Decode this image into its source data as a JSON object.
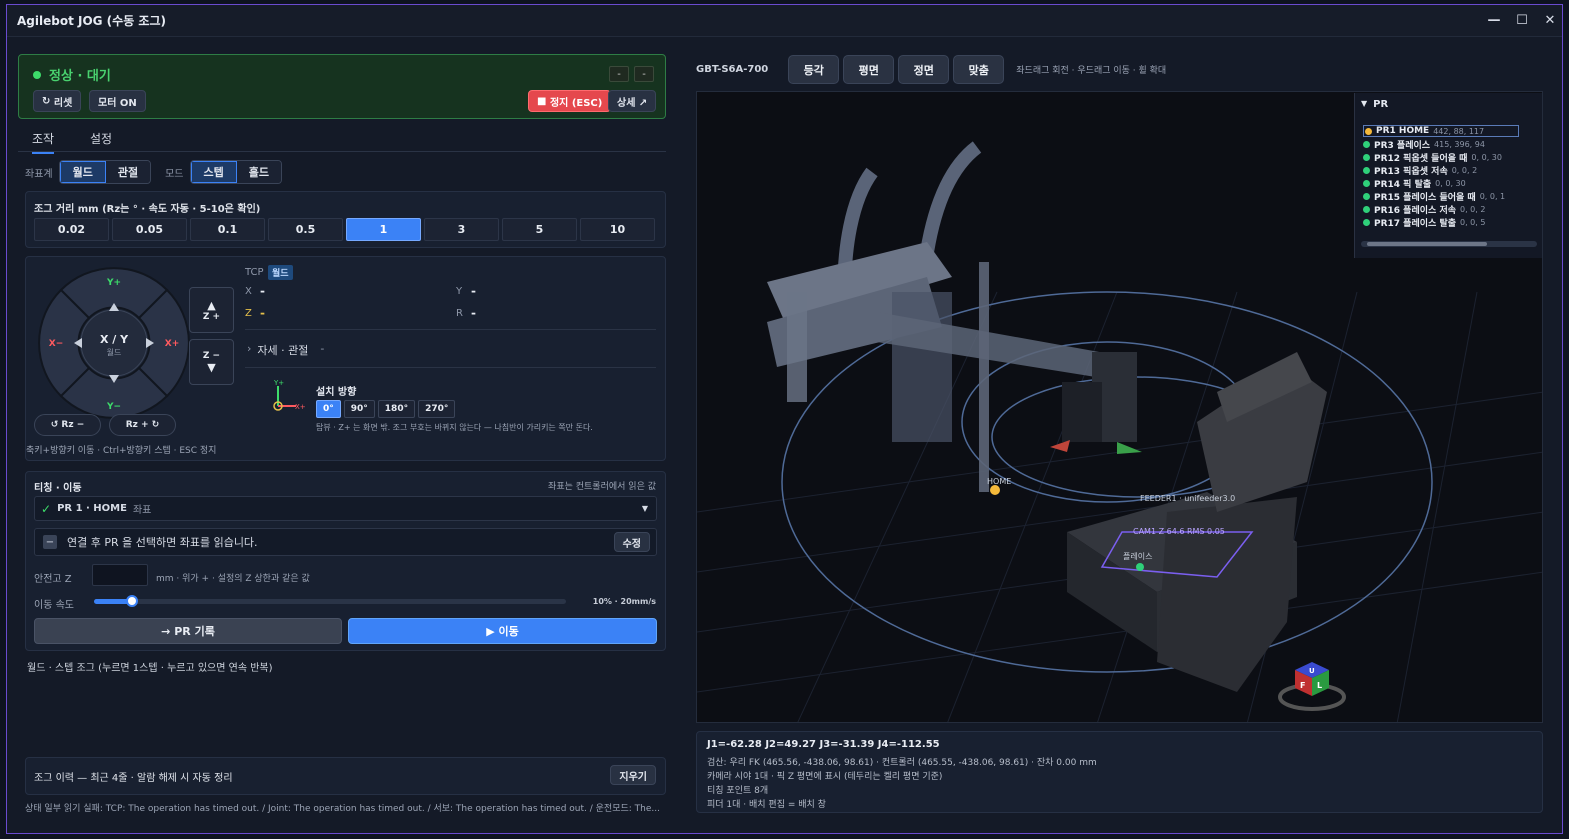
{
  "window": {
    "title": "Agilebot JOG (수동 조그)",
    "controls": [
      "—",
      "☐",
      "✕"
    ]
  },
  "status": {
    "title": "정상 · 대기",
    "mini_a": "-",
    "mini_b": "-",
    "reset": "리셋",
    "motor_on": "모터 ON",
    "stop": "정지 (ESC)",
    "detail": "상세 ↗"
  },
  "tabs": [
    "조작",
    "설정"
  ],
  "coords": {
    "frame_label": "좌표계",
    "frame_world": "월드",
    "frame_joint": "관절",
    "mode_label": "모드",
    "mode_step": "스텝",
    "mode_hold": "홀드"
  },
  "jog_distance": {
    "header": "조그 거리 mm (Rz는 ° · 속도 자동 · 5-10은 확인)",
    "steps": [
      "0.02",
      "0.05",
      "0.1",
      "0.5",
      "1",
      "3",
      "5",
      "10"
    ],
    "selected": "1"
  },
  "pad": {
    "y_plus": "Y+",
    "y_minus": "Y−",
    "x_minus": "X−",
    "x_plus": "X+",
    "center": "X / Y",
    "center_sub": "월드",
    "z_plus": "Z +",
    "z_minus": "Z −",
    "rz_minus": "Rz −",
    "rz_plus": "Rz +",
    "hint": "축키+방향키 이동 · Ctrl+방향키 스텝 · ESC 정지"
  },
  "tcp": {
    "label": "TCP",
    "frame": "월드",
    "x_label": "X",
    "x_val": "-",
    "y_label": "Y",
    "y_val": "-",
    "z_label": "Z",
    "z_val": "-",
    "r_label": "R",
    "r_val": "-",
    "posture": "자세 · 관절",
    "posture_val": "-",
    "install_title": "설치 방향",
    "install_opts": [
      "0°",
      "90°",
      "180°",
      "270°"
    ],
    "install_selected": "0°",
    "axis_y": "Y+",
    "axis_x": "X+",
    "install_note": "탑뷰 · Z+ 는 화면 밖. 조그 부호는 바뀌지 않는다 — 나침반이 가리키는 쪽만 돈다."
  },
  "teach": {
    "title": "티칭 · 이동",
    "note": "좌표는 컨트롤러에서 읽은 값",
    "pr_name": "PR 1 · HOME",
    "pr_tag": "좌표",
    "info": "연결 후 PR 을 선택하면 좌표를 읽습니다.",
    "edit": "수정",
    "safe_z_label": "안전고 Z",
    "safe_z_value": "",
    "safe_z_note": "mm · 위가 + · 설정의 Z 상한과 같은 값",
    "speed_label": "이동 속도",
    "speed_value": "10% · 20mm/s",
    "speed_fraction": 0.08,
    "record": "→ PR 기록",
    "move": "▶ 이동"
  },
  "footer_hint": "월드 · 스텝 조그 (누르면 1스텝 · 누르고 있으면 연속 반복)",
  "history": {
    "title": "조그 이력 — 최근 4줄 · 알람 해제 시 자동 정리",
    "clear": "지우기"
  },
  "error_line": "상태 일부 읽기 실패: TCP: The operation has timed out. / Joint: The operation has timed out. / 서보: The operation has timed out. / 운전모드: The...",
  "viewer": {
    "model": "GBT-S6A-700",
    "views": [
      "등각",
      "평면",
      "정면",
      "맞춤"
    ],
    "hint": "좌드래그 회전 · 우드래그 이동 · 휠 확대",
    "label_home": "HOME",
    "label_feeder": "FEEDER1 · unifeeder3.0",
    "label_cam": "CAM1  Z 64.6  RMS 0.05",
    "label_place": "플레이스",
    "gizmo_top": "U",
    "gizmo_front": "F",
    "gizmo_left": "L"
  },
  "pr_panel": {
    "title": "PR",
    "items": [
      {
        "name": "PR1 HOME",
        "coords": "442, 88, 117",
        "color": "#f5b93a"
      },
      {
        "name": "PR3 플레이스",
        "coords": "415, 396, 94",
        "color": "#2fd07a"
      },
      {
        "name": "PR12 픽옵셋 들어올 때",
        "coords": "0, 0, 30",
        "color": "#2fd07a"
      },
      {
        "name": "PR13 픽옵셋 저속",
        "coords": "0, 0, 2",
        "color": "#2fd07a"
      },
      {
        "name": "PR14 픽 탈출",
        "coords": "0, 0, 30",
        "color": "#2fd07a"
      },
      {
        "name": "PR15 플레이스 들어올 때",
        "coords": "0, 0, 1",
        "color": "#2fd07a"
      },
      {
        "name": "PR16 플레이스 저속",
        "coords": "0, 0, 2",
        "color": "#2fd07a"
      },
      {
        "name": "PR17 플레이스 탈출",
        "coords": "0, 0, 5",
        "color": "#2fd07a"
      }
    ]
  },
  "joint_status": {
    "joints": "J1=-62.28   J2=49.27   J3=-31.39   J4=-112.55",
    "verify": "검산: 우리 FK (465.56, -438.06, 98.61) · 컨트롤러 (465.55, -438.06, 98.61) · 잔차 0.00 mm",
    "camera": "카메라 시야 1대 · 픽 Z 평면에 표시 (테두리는 켈리 평면 기준)",
    "teach_points": "티칭 포인트 8개",
    "feeder": "피더 1대 · 배치 편집 = 배치 창"
  }
}
